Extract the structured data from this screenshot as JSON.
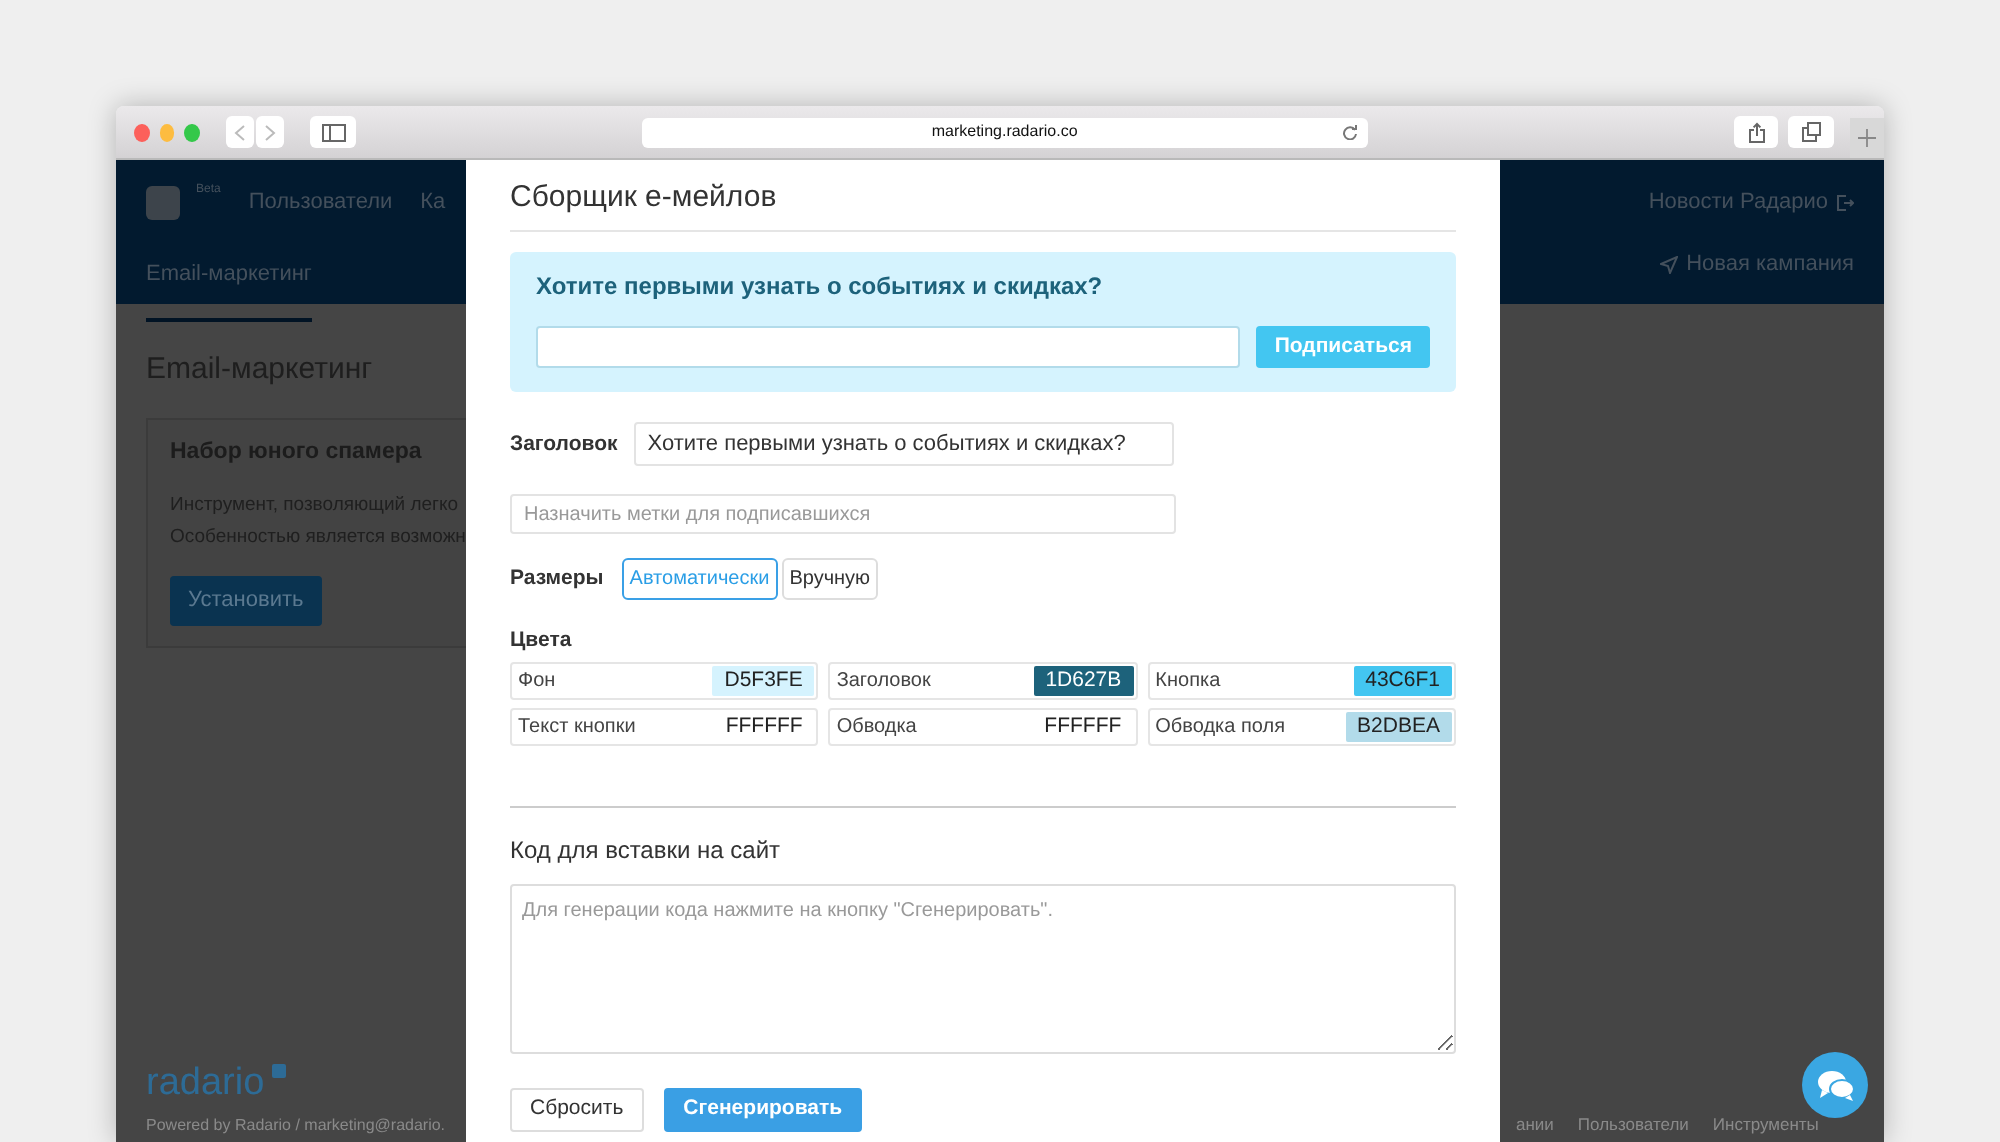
{
  "browser": {
    "url": "marketing.radario.co"
  },
  "navbar": {
    "badge": "Beta",
    "items": [
      {
        "label": "Пользователи"
      },
      {
        "label": "Ка"
      }
    ],
    "subnav": [
      {
        "label": "Email-маркетинг",
        "selected": true
      }
    ],
    "news_link": "Новости Радарио",
    "new_campaign": "Новая кампания"
  },
  "page": {
    "title": "Email-маркетинг",
    "card": {
      "title": "Набор юного спамера",
      "lines": [
        "Инструмент, позволяющий легко",
        "Особенностью является возможн"
      ],
      "button": "Установить"
    }
  },
  "footer": {
    "logo": "radario",
    "powered": "Powered by Radario / marketing@radario.",
    "links": [
      "ании",
      "Пользователи",
      "Инструменты"
    ]
  },
  "modal": {
    "title": "Сборщик е-мейлов",
    "preview": {
      "heading": "Хотите первыми узнать о событиях и скидках?",
      "button": "Подписаться"
    },
    "heading_field": {
      "label": "Заголовок",
      "value": "Хотите первыми узнать о событиях и скидках?"
    },
    "tags_field": {
      "placeholder": "Назначить метки для подписавшихся"
    },
    "sizes": {
      "label": "Размеры",
      "options": [
        {
          "label": "Автоматически",
          "selected": true
        },
        {
          "label": "Вручную",
          "selected": false
        }
      ]
    },
    "colors": {
      "label": "Цвета",
      "items": [
        {
          "label": "Фон",
          "value": "D5F3FE",
          "color": "#d5f3fe"
        },
        {
          "label": "Заголовок",
          "value": "1D627B",
          "color": "#1d627b"
        },
        {
          "label": "Кнопка",
          "value": "43C6F1",
          "color": "#43c6f1"
        },
        {
          "label": "Текст кнопки",
          "value": "FFFFFF",
          "color": "#ffffff"
        },
        {
          "label": "Обводка",
          "value": "FFFFFF",
          "color": "#ffffff"
        },
        {
          "label": "Обводка поля",
          "value": "B2DBEA",
          "color": "#b2dbea"
        }
      ]
    },
    "embed": {
      "label": "Код для вставки на сайт",
      "placeholder": "Для генерации кода нажмите на кнопку \"Сгенерировать\"."
    },
    "buttons": [
      {
        "label": "Сбросить",
        "kind": "default"
      },
      {
        "label": "Сгенерировать",
        "kind": "primary"
      }
    ]
  }
}
